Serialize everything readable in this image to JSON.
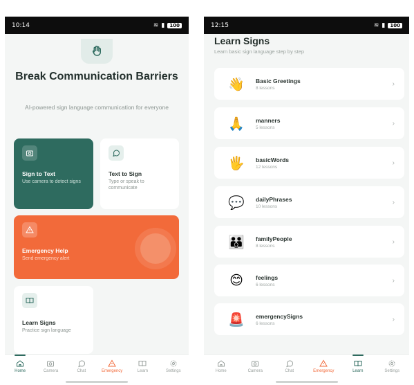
{
  "left": {
    "status": {
      "time": "10:14",
      "battery": "100"
    },
    "hero": {
      "title": "Break Communication Barriers",
      "subtitle": "AI-powered sign language communication for everyone"
    },
    "cards": {
      "sign_to_text": {
        "title": "Sign to Text",
        "desc": "Use camera to detect signs"
      },
      "text_to_sign": {
        "title": "Text to Sign",
        "desc": "Type or speak to communicate"
      },
      "emergency": {
        "title": "Emergency Help",
        "desc": "Send emergency alert"
      },
      "learn": {
        "title": "Learn Signs",
        "desc": "Practice sign language"
      }
    },
    "nav": [
      "Home",
      "Camera",
      "Chat",
      "Emergency",
      "Learn",
      "Settings"
    ]
  },
  "right": {
    "status": {
      "time": "12:15",
      "battery": "100"
    },
    "title": "Learn Signs",
    "subtitle": "Learn basic sign language step by step",
    "lessons": [
      {
        "emoji": "👋",
        "name": "Basic Greetings",
        "count": "8 lessons"
      },
      {
        "emoji": "🙏",
        "name": "manners",
        "count": "5 lessons"
      },
      {
        "emoji": "🖐",
        "name": "basicWords",
        "count": "12 lessons"
      },
      {
        "emoji": "💬",
        "name": "dailyPhrases",
        "count": "10 lessons"
      },
      {
        "emoji": "👪",
        "name": "familyPeople",
        "count": "8 lessons"
      },
      {
        "emoji": "😊",
        "name": "feelings",
        "count": "6 lessons"
      },
      {
        "emoji": "🚨",
        "name": "emergencySigns",
        "count": "6 lessons"
      }
    ],
    "nav": [
      "Home",
      "Camera",
      "Chat",
      "Emergency",
      "Learn",
      "Settings"
    ]
  },
  "colors": {
    "primary": "#2e6b5f",
    "emergency": "#f26a3a",
    "background": "#f4f6f5"
  }
}
